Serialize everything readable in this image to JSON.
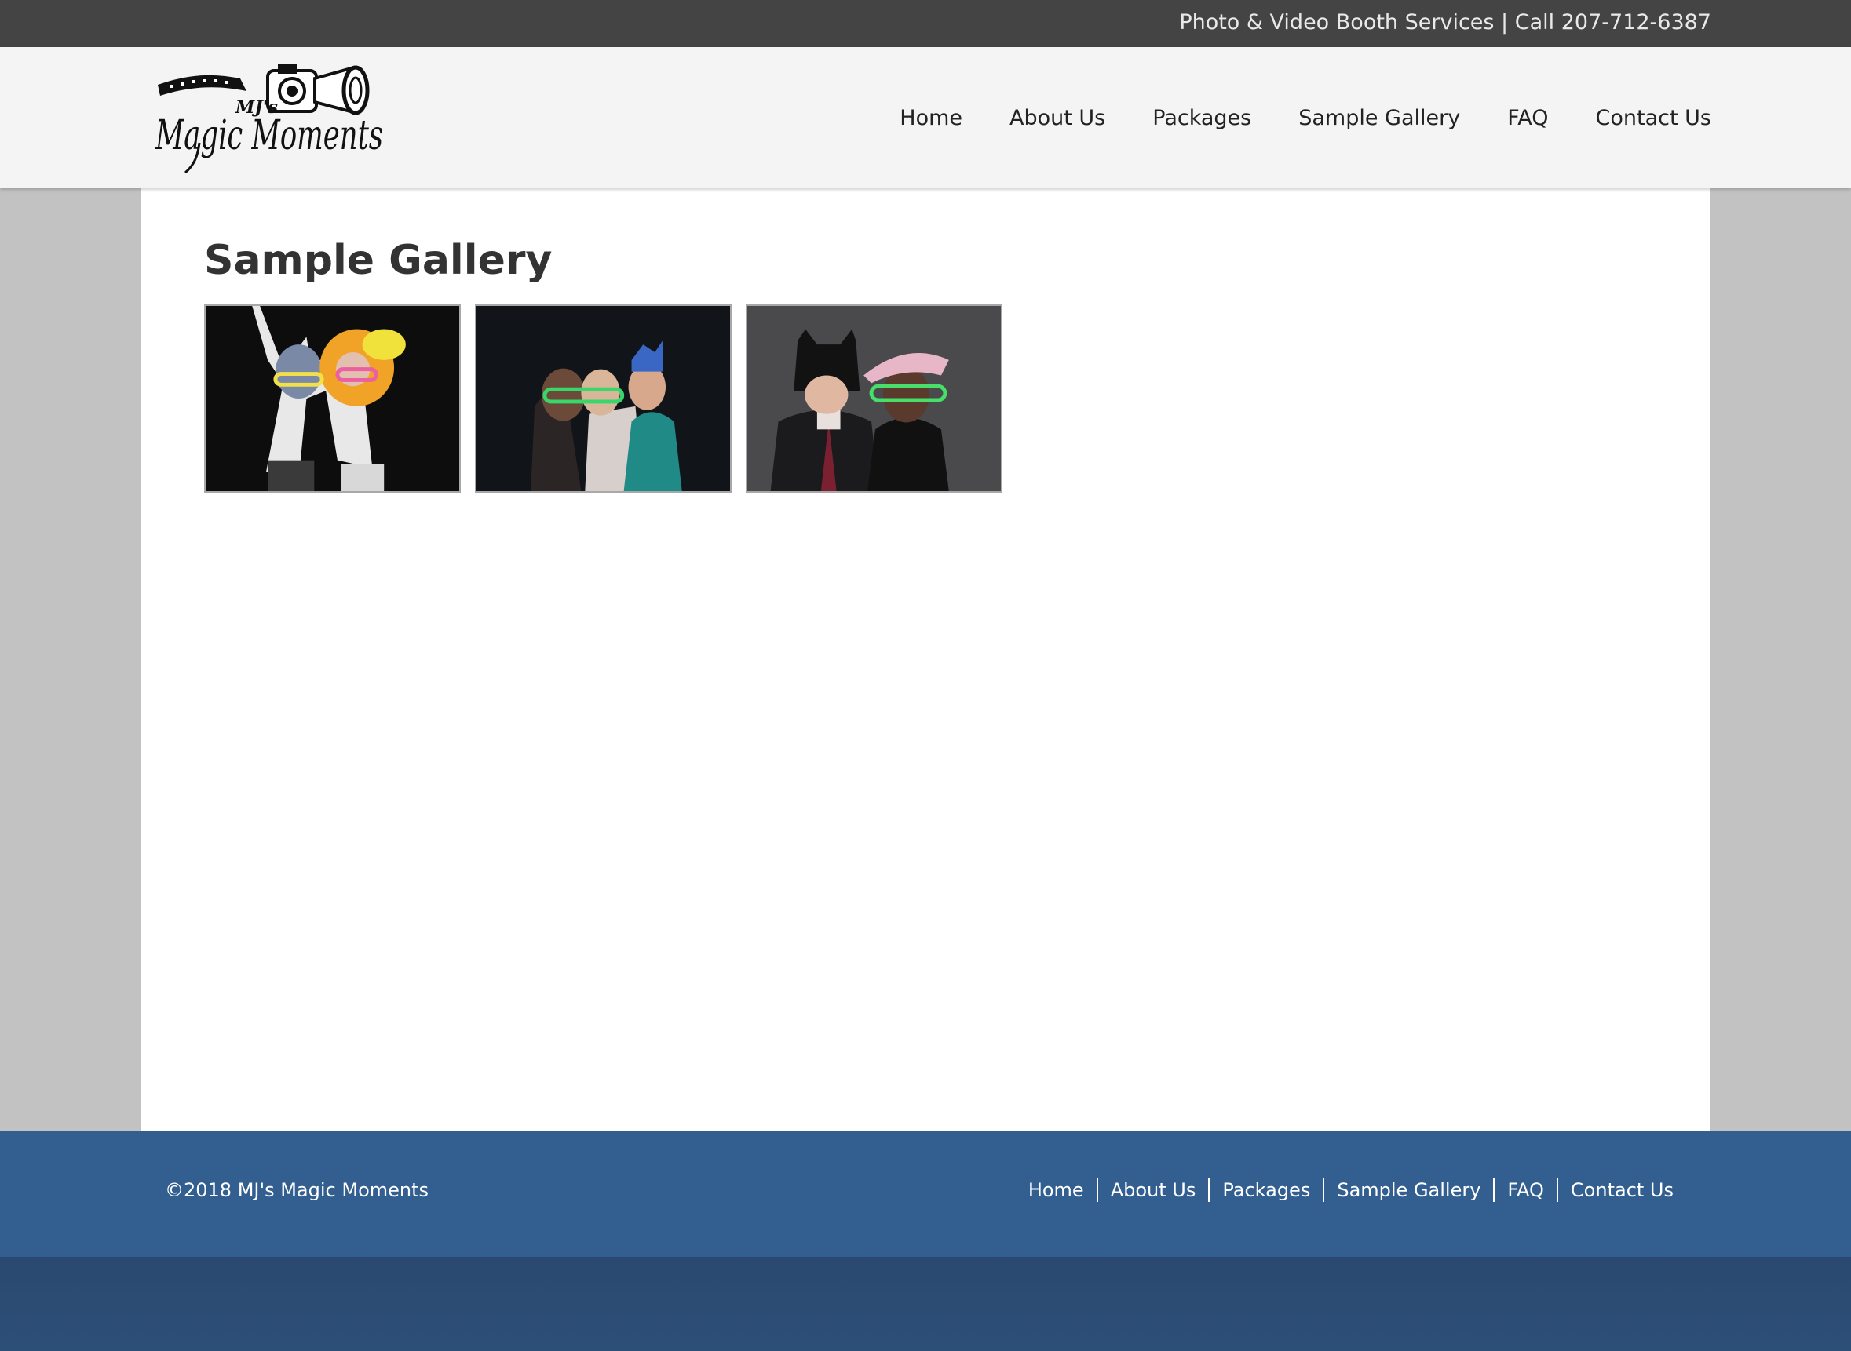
{
  "topbar": {
    "contact_text": "Photo & Video Booth Services | Call 207-712-6387"
  },
  "header": {
    "logo_text_top": "MJ's",
    "logo_text_main": "Magic Moments",
    "nav": [
      "Home",
      "About Us",
      "Packages",
      "Sample Gallery",
      "FAQ",
      "Contact Us"
    ]
  },
  "main": {
    "title": "Sample Gallery",
    "thumbnails": [
      {
        "icon": "photo-booth-image-1"
      },
      {
        "icon": "photo-booth-image-2"
      },
      {
        "icon": "photo-booth-image-3"
      }
    ]
  },
  "footer": {
    "copyright": "©2018 MJ's Magic Moments",
    "nav": [
      "Home",
      "About Us",
      "Packages",
      "Sample Gallery",
      "FAQ",
      "Contact Us"
    ]
  },
  "colors": {
    "topbar": "#444444",
    "header": "#f4f4f4",
    "page_bg": "#c2c2c2",
    "footer": "#325f90",
    "bottom_band": "#2c4c74"
  }
}
